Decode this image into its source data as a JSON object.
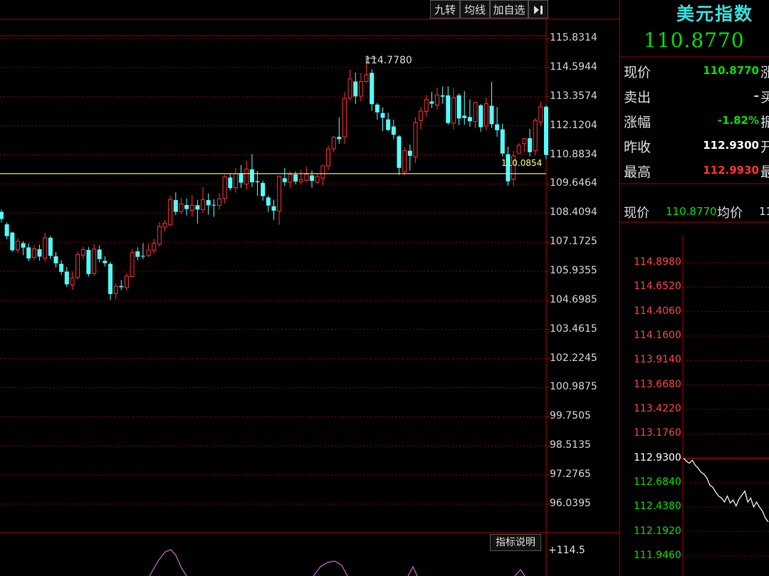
{
  "toolbar": {
    "btn_jiuzhuan": "九转",
    "btn_junxian": "均线",
    "btn_jiazixuan": "加自选",
    "btn_collapse_icon": "collapse-right-icon"
  },
  "quote": {
    "title": "美元指数",
    "price": "110.8770",
    "rows": [
      {
        "label": "现价",
        "value": "110.8770",
        "color": "#00e000",
        "trail": "涨"
      },
      {
        "label": "卖出",
        "value": "–",
        "color": "#dddddd",
        "trail": "买"
      },
      {
        "label": "涨幅",
        "value": "-1.82%",
        "color": "#00e000",
        "trail": "振"
      },
      {
        "label": "昨收",
        "value": "112.9300",
        "color": "#ffffff",
        "trail": "开"
      },
      {
        "label": "最高",
        "value": "112.9930",
        "color": "#ff3333",
        "trail": "最"
      }
    ],
    "strip": {
      "label1": "现价",
      "value1": "110.8770",
      "label2": "均价",
      "value2": "11"
    }
  },
  "indicator_button": "指标说明",
  "indicator_top_label": "+114.5",
  "colors": {
    "up": "#ff3030",
    "down": "#54ffff",
    "grid": "#8a0000",
    "axis": "#aa0000",
    "hline": "#e8e85a",
    "intraday": "#ffffff"
  },
  "chart_data": [
    {
      "type": "candlestick",
      "title": "美元指数",
      "ylim": [
        96.0395,
        115.8314
      ],
      "y_ticks": [
        "115.8314",
        "114.5944",
        "113.3574",
        "112.1204",
        "110.8834",
        "109.6464",
        "108.4094",
        "107.1725",
        "105.9355",
        "104.6985",
        "103.4615",
        "102.2245",
        "100.9875",
        "99.7505",
        "98.5135",
        "97.2765",
        "96.0395"
      ],
      "annotations": {
        "high_label": "114.7780",
        "line_label": "110.0854",
        "line_value": 110.0854
      },
      "candles": [
        [
          108.46,
          108.16,
          108.56,
          108.0
        ],
        [
          107.93,
          107.43,
          108.01,
          107.3
        ],
        [
          107.58,
          106.83,
          107.61,
          106.77
        ],
        [
          106.84,
          107.21,
          107.33,
          106.7
        ],
        [
          107.13,
          106.94,
          107.22,
          106.62
        ],
        [
          106.95,
          106.48,
          107.12,
          106.37
        ],
        [
          106.52,
          106.89,
          107.05,
          106.4
        ],
        [
          106.87,
          106.56,
          107.06,
          106.38
        ],
        [
          106.49,
          107.36,
          107.57,
          106.35
        ],
        [
          107.36,
          106.59,
          107.44,
          106.46
        ],
        [
          106.57,
          106.27,
          106.75,
          106.1
        ],
        [
          106.25,
          105.91,
          106.41,
          105.78
        ],
        [
          105.92,
          105.38,
          106.11,
          105.27
        ],
        [
          105.35,
          105.65,
          105.93,
          105.15
        ],
        [
          105.67,
          106.65,
          106.79,
          105.58
        ],
        [
          106.62,
          106.86,
          106.98,
          106.45
        ],
        [
          106.84,
          105.82,
          106.96,
          105.71
        ],
        [
          105.84,
          106.88,
          107.11,
          105.74
        ],
        [
          106.86,
          106.45,
          107.04,
          106.32
        ],
        [
          106.38,
          106.28,
          106.57,
          106.14
        ],
        [
          106.25,
          104.97,
          106.33,
          104.72
        ],
        [
          104.99,
          105.3,
          105.42,
          104.75
        ],
        [
          105.31,
          105.26,
          105.56,
          105.13
        ],
        [
          105.24,
          105.73,
          105.86,
          105.1
        ],
        [
          105.71,
          106.73,
          106.88,
          105.69
        ],
        [
          106.78,
          106.55,
          106.96,
          106.4
        ],
        [
          106.59,
          106.58,
          107.13,
          106.45
        ],
        [
          106.61,
          106.84,
          107.11,
          106.54
        ],
        [
          106.83,
          107.12,
          107.31,
          106.7
        ],
        [
          107.09,
          107.84,
          108.03,
          106.99
        ],
        [
          107.81,
          107.98,
          108.12,
          107.63
        ],
        [
          107.91,
          108.99,
          109.14,
          107.86
        ],
        [
          108.96,
          108.46,
          109.29,
          108.32
        ],
        [
          108.48,
          108.8,
          109.06,
          108.36
        ],
        [
          108.75,
          108.58,
          109.03,
          108.31
        ],
        [
          108.52,
          108.74,
          109.17,
          108.25
        ],
        [
          108.74,
          108.56,
          108.97,
          107.96
        ],
        [
          108.56,
          108.98,
          109.51,
          108.41
        ],
        [
          108.96,
          108.74,
          109.24,
          108.34
        ],
        [
          108.76,
          108.74,
          109.0,
          108.25
        ],
        [
          108.73,
          109.01,
          109.26,
          108.57
        ],
        [
          109.03,
          109.95,
          110.04,
          108.82
        ],
        [
          109.92,
          109.47,
          110.07,
          109.38
        ],
        [
          109.49,
          110.08,
          110.33,
          109.28
        ],
        [
          110.11,
          109.7,
          110.45,
          109.48
        ],
        [
          109.64,
          110.28,
          110.64,
          109.39
        ],
        [
          110.27,
          109.72,
          110.92,
          109.52
        ],
        [
          109.76,
          109.72,
          110.2,
          109.14
        ],
        [
          109.69,
          109.13,
          109.79,
          108.94
        ],
        [
          109.07,
          108.73,
          109.16,
          108.45
        ],
        [
          108.7,
          108.51,
          108.98,
          108.12
        ],
        [
          108.49,
          109.98,
          110.0,
          107.91
        ],
        [
          109.89,
          109.72,
          110.33,
          109.56
        ],
        [
          109.72,
          110.05,
          110.19,
          109.48
        ],
        [
          110.05,
          109.75,
          110.18,
          109.63
        ],
        [
          109.74,
          109.83,
          110.26,
          109.62
        ],
        [
          109.8,
          110.06,
          110.38,
          109.75
        ],
        [
          110.01,
          109.78,
          110.22,
          109.49
        ],
        [
          109.72,
          109.96,
          110.1,
          109.66
        ],
        [
          109.9,
          110.42,
          110.41,
          109.59
        ],
        [
          110.41,
          111.13,
          111.29,
          110.23
        ],
        [
          111.14,
          111.63,
          111.7,
          110.99
        ],
        [
          111.65,
          111.55,
          112.48,
          111.36
        ],
        [
          111.65,
          113.28,
          113.55,
          111.34
        ],
        [
          113.3,
          114.11,
          114.51,
          113.19
        ],
        [
          114.0,
          113.37,
          114.38,
          113.04
        ],
        [
          113.38,
          114.0,
          114.36,
          113.16
        ],
        [
          114.0,
          114.29,
          114.78,
          113.96
        ],
        [
          114.37,
          113.04,
          114.52,
          112.76
        ],
        [
          113.02,
          112.69,
          113.09,
          112.38
        ],
        [
          112.66,
          112.46,
          112.9,
          111.9
        ],
        [
          112.39,
          111.94,
          112.68,
          111.89
        ],
        [
          112.09,
          111.74,
          112.38,
          111.55
        ],
        [
          111.67,
          110.33,
          111.72,
          110.03
        ],
        [
          110.16,
          111.06,
          111.21,
          110.01
        ],
        [
          111.06,
          110.84,
          111.32,
          110.21
        ],
        [
          110.8,
          112.26,
          112.48,
          110.53
        ],
        [
          112.35,
          112.74,
          112.91,
          111.96
        ],
        [
          112.73,
          113.23,
          113.42,
          112.51
        ],
        [
          113.15,
          113.06,
          113.56,
          112.87
        ],
        [
          113.0,
          113.43,
          113.74,
          112.8
        ],
        [
          113.41,
          113.36,
          113.79,
          113.06
        ],
        [
          113.41,
          112.24,
          113.79,
          112.17
        ],
        [
          112.23,
          113.31,
          113.73,
          111.97
        ],
        [
          113.41,
          112.43,
          113.49,
          112.15
        ],
        [
          112.55,
          112.45,
          113.6,
          112.17
        ],
        [
          112.49,
          112.31,
          113.24,
          112.08
        ],
        [
          112.3,
          113.11,
          113.14,
          112.01
        ],
        [
          112.99,
          112.06,
          113.05,
          111.87
        ],
        [
          112.11,
          113.06,
          113.32,
          111.92
        ],
        [
          112.97,
          112.19,
          113.98,
          112.03
        ],
        [
          112.18,
          111.93,
          112.92,
          111.65
        ],
        [
          111.97,
          110.94,
          112.21,
          110.81
        ],
        [
          110.91,
          109.76,
          111.23,
          109.57
        ],
        [
          109.85,
          110.84,
          111.06,
          109.55
        ],
        [
          110.95,
          111.29,
          111.39,
          110.93
        ],
        [
          111.36,
          111.57,
          111.59,
          111.0
        ],
        [
          111.59,
          111.0,
          111.99,
          110.81
        ],
        [
          111.06,
          112.35,
          112.44,
          110.86
        ],
        [
          112.28,
          112.93,
          113.15,
          112.12
        ],
        [
          112.93,
          110.88,
          112.99,
          110.7
        ]
      ]
    },
    {
      "type": "line",
      "title": "",
      "y_ticks": [
        "114.8980",
        "114.6520",
        "114.4060",
        "114.1600",
        "113.9140",
        "113.6680",
        "113.4220",
        "113.1760",
        "112.9300",
        "112.6840",
        "112.4380",
        "112.1920",
        "111.9460"
      ],
      "baseline": 112.93,
      "ylim": [
        111.946,
        114.898
      ],
      "values": [
        112.93,
        112.9,
        112.88,
        112.91,
        112.86,
        112.83,
        112.79,
        112.77,
        112.73,
        112.66,
        112.64,
        112.59,
        112.55,
        112.53,
        112.49,
        112.55,
        112.48,
        112.51,
        112.45,
        112.52,
        112.56,
        112.6,
        112.49,
        112.53,
        112.44,
        112.49,
        112.44,
        112.4,
        112.33,
        112.29
      ]
    }
  ]
}
